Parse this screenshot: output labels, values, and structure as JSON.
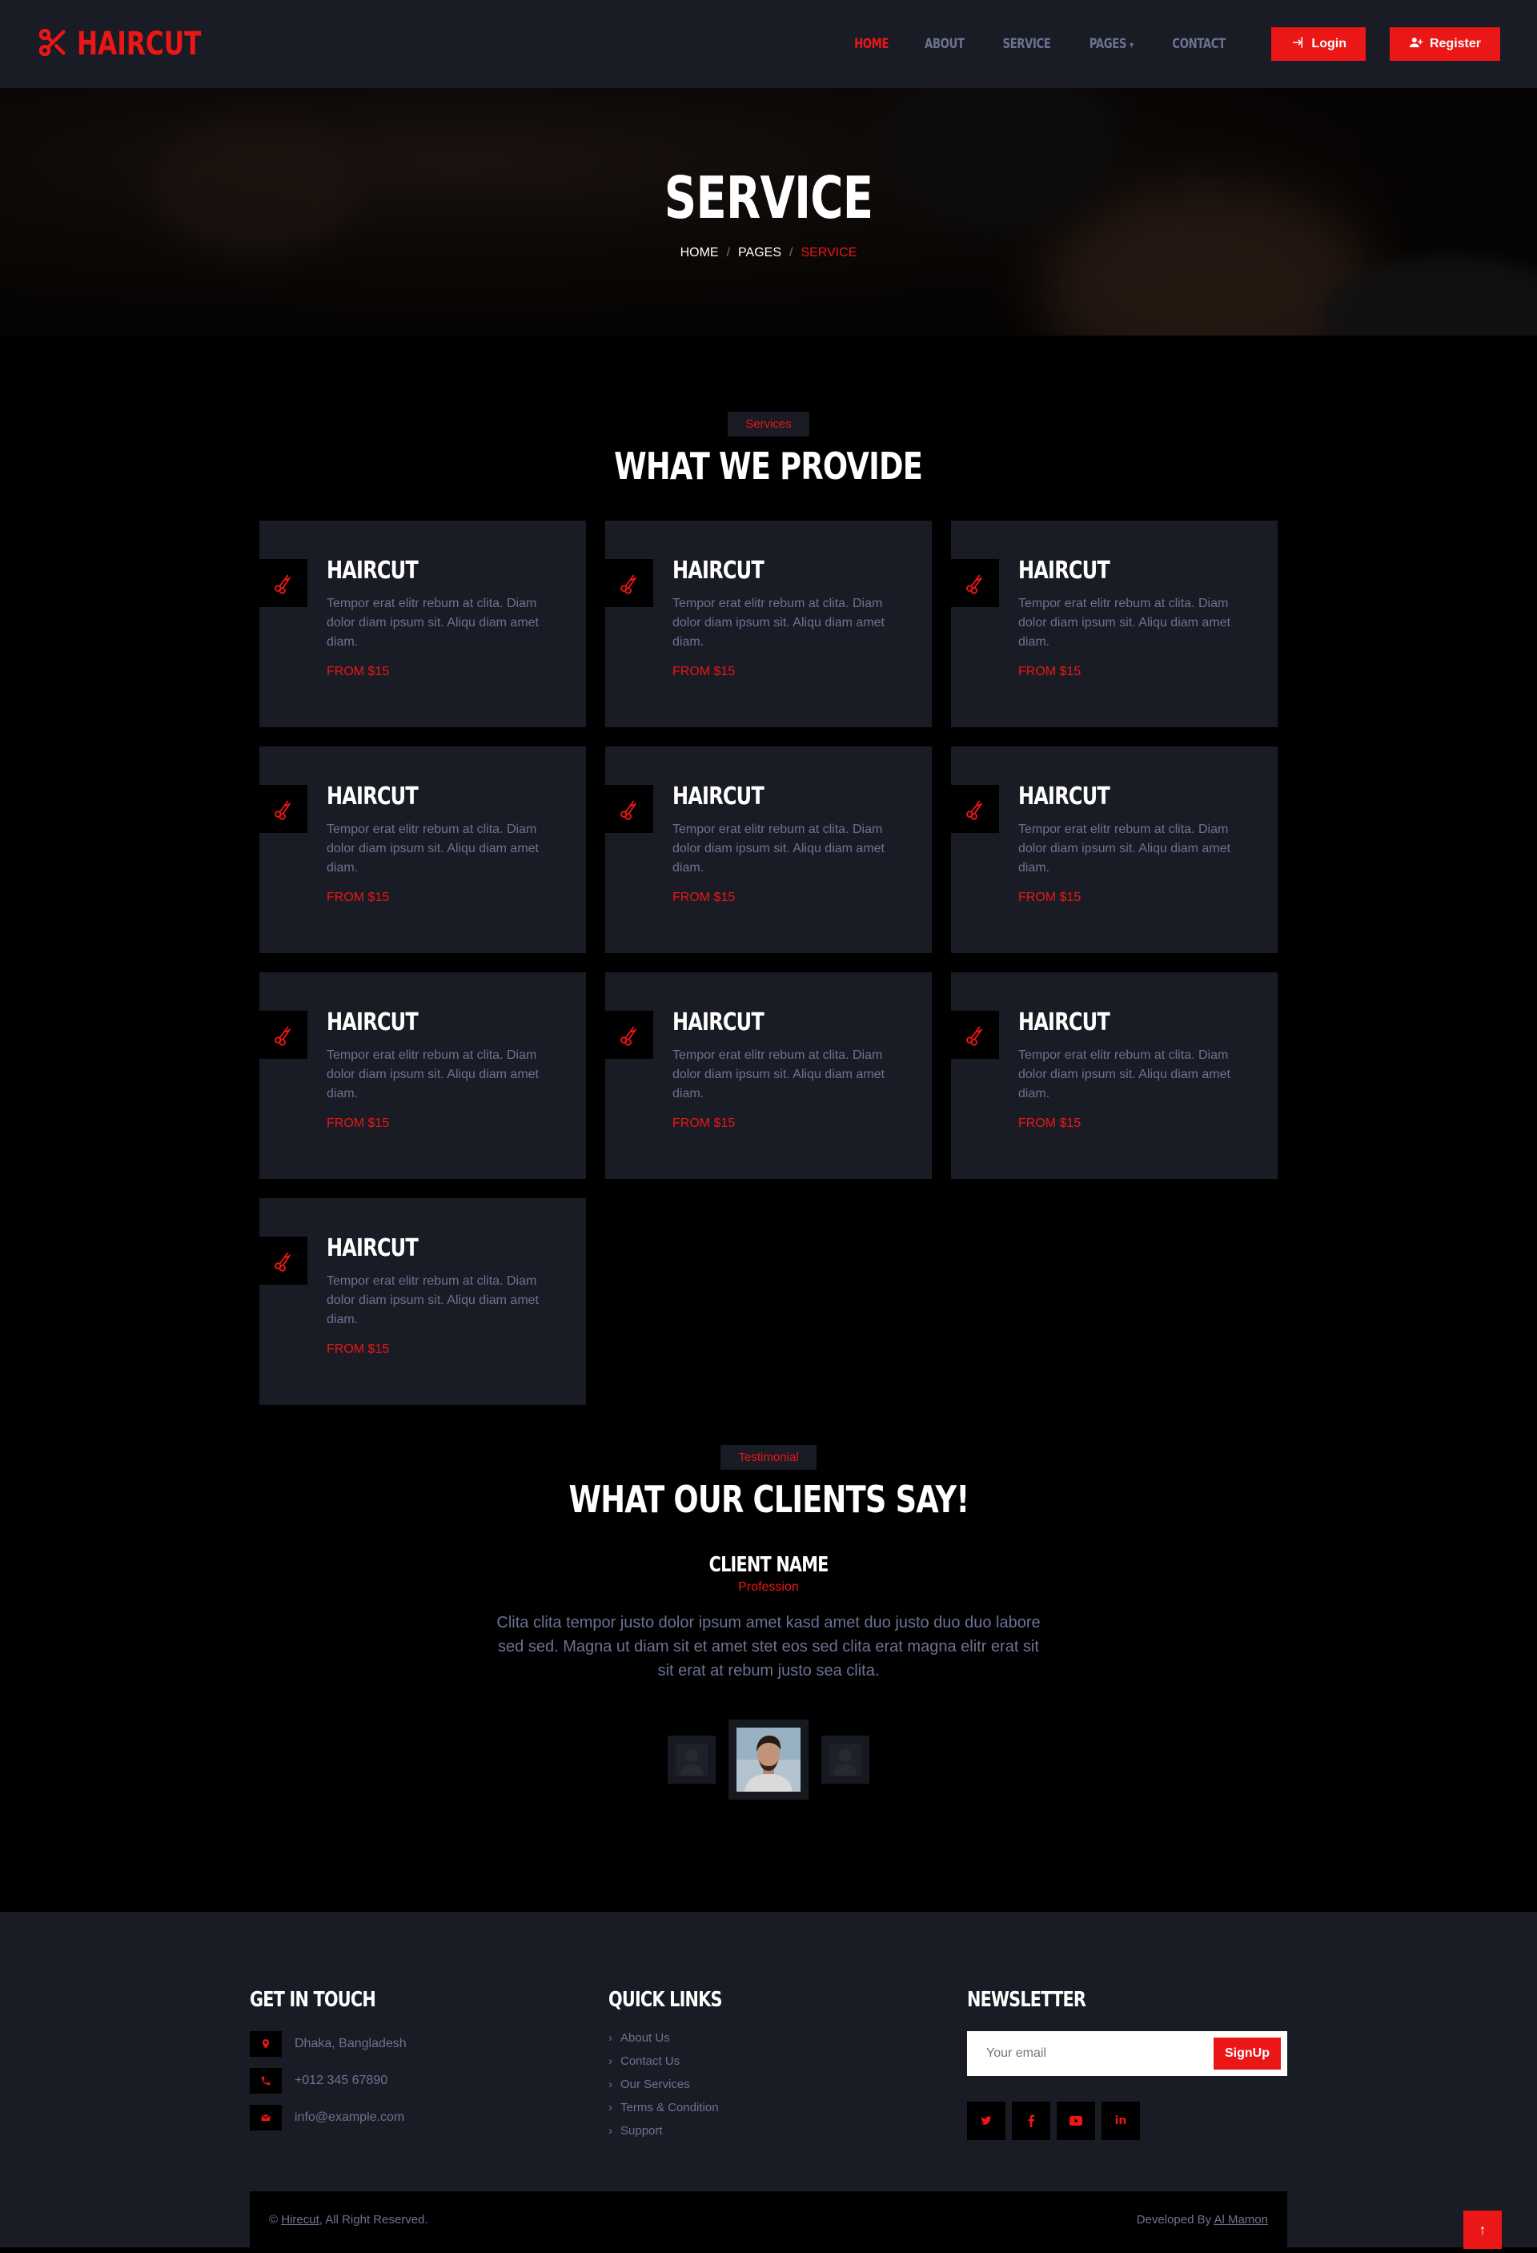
{
  "brand": {
    "name": "HAIRCUT"
  },
  "nav": {
    "links": [
      "HOME",
      "ABOUT",
      "SERVICE",
      "PAGES",
      "CONTACT"
    ],
    "login": "Login",
    "register": "Register"
  },
  "hero": {
    "title": "SERVICE",
    "breadcrumb": [
      "HOME",
      "PAGES",
      "SERVICE"
    ]
  },
  "services": {
    "badge": "Services",
    "title": "WHAT WE PROVIDE",
    "items": [
      {
        "title": "HAIRCUT",
        "text": "Tempor erat elitr rebum at clita. Diam dolor diam ipsum sit. Aliqu diam amet diam.",
        "price": "FROM $15"
      },
      {
        "title": "HAIRCUT",
        "text": "Tempor erat elitr rebum at clita. Diam dolor diam ipsum sit. Aliqu diam amet diam.",
        "price": "FROM $15"
      },
      {
        "title": "HAIRCUT",
        "text": "Tempor erat elitr rebum at clita. Diam dolor diam ipsum sit. Aliqu diam amet diam.",
        "price": "FROM $15"
      },
      {
        "title": "HAIRCUT",
        "text": "Tempor erat elitr rebum at clita. Diam dolor diam ipsum sit. Aliqu diam amet diam.",
        "price": "FROM $15"
      },
      {
        "title": "HAIRCUT",
        "text": "Tempor erat elitr rebum at clita. Diam dolor diam ipsum sit. Aliqu diam amet diam.",
        "price": "FROM $15"
      },
      {
        "title": "HAIRCUT",
        "text": "Tempor erat elitr rebum at clita. Diam dolor diam ipsum sit. Aliqu diam amet diam.",
        "price": "FROM $15"
      },
      {
        "title": "HAIRCUT",
        "text": "Tempor erat elitr rebum at clita. Diam dolor diam ipsum sit. Aliqu diam amet diam.",
        "price": "FROM $15"
      },
      {
        "title": "HAIRCUT",
        "text": "Tempor erat elitr rebum at clita. Diam dolor diam ipsum sit. Aliqu diam amet diam.",
        "price": "FROM $15"
      },
      {
        "title": "HAIRCUT",
        "text": "Tempor erat elitr rebum at clita. Diam dolor diam ipsum sit. Aliqu diam amet diam.",
        "price": "FROM $15"
      },
      {
        "title": "HAIRCUT",
        "text": "Tempor erat elitr rebum at clita. Diam dolor diam ipsum sit. Aliqu diam amet diam.",
        "price": "FROM $15"
      }
    ]
  },
  "testimonial": {
    "badge": "Testimonial",
    "title": "WHAT OUR CLIENTS SAY!",
    "client_name": "CLIENT NAME",
    "profession": "Profession",
    "quote": "Clita clita tempor justo dolor ipsum amet kasd amet duo justo duo duo labore sed sed. Magna ut diam sit et amet stet eos sed clita erat magna elitr erat sit sit erat at rebum justo sea clita."
  },
  "footer": {
    "contact_title": "GET IN TOUCH",
    "address": "Dhaka, Bangladesh",
    "phone": "+012 345 67890",
    "email": "info@example.com",
    "links_title": "QUICK LINKS",
    "links": [
      "About Us",
      "Contact Us",
      "Our Services",
      "Terms & Condition",
      "Support"
    ],
    "newsletter_title": "NEWSLETTER",
    "newsletter_placeholder": "Your email",
    "signup": "SignUp",
    "copyright_prefix": "©",
    "copyright_link": "Hirecut",
    "copyright_suffix": ", All Right Reserved.",
    "developed_prefix": "Developed By",
    "developer": "Al Mamon"
  },
  "colors": {
    "accent": "#eb1616",
    "card": "#191c24",
    "muted": "#6c7293"
  }
}
